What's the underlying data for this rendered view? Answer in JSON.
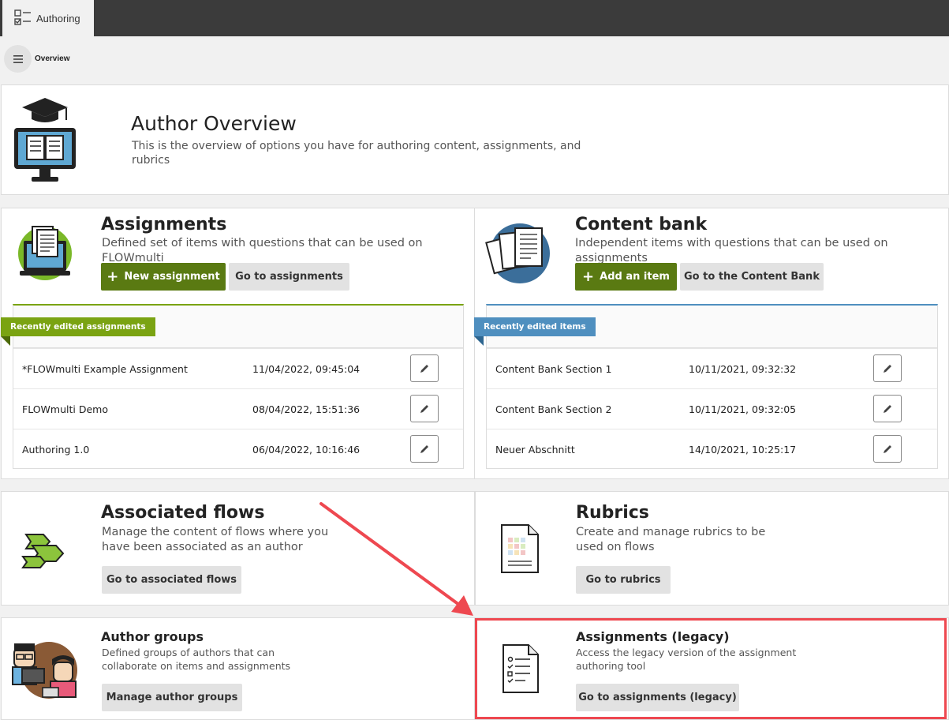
{
  "app": {
    "tab_label": "Authoring",
    "breadcrumb": "Overview"
  },
  "header": {
    "title": "Author Overview",
    "description": "This is the overview of options you have for authoring content, assignments, and rubrics"
  },
  "assignments": {
    "title": "Assignments",
    "description": "Defined set of items with questions that can be used on FLOWmulti",
    "new_button": "New assignment",
    "go_button": "Go to assignments",
    "recent_label": "Recently edited assignments",
    "rows": [
      {
        "name": "*FLOWmulti Example Assignment",
        "date": "11/04/2022, 09:45:04"
      },
      {
        "name": "FLOWmulti Demo",
        "date": "08/04/2022, 15:51:36"
      },
      {
        "name": "Authoring 1.0",
        "date": "06/04/2022, 10:16:46"
      }
    ]
  },
  "content_bank": {
    "title": "Content bank",
    "description": "Independent items with questions that can be used on assignments",
    "add_button": "Add an item",
    "go_button": "Go to the Content Bank",
    "recent_label": "Recently edited items",
    "rows": [
      {
        "name": "Content Bank Section 1",
        "date": "10/11/2021, 09:32:32"
      },
      {
        "name": "Content Bank Section 2",
        "date": "10/11/2021, 09:32:05"
      },
      {
        "name": "Neuer Abschnitt",
        "date": "14/10/2021, 10:25:17"
      }
    ]
  },
  "flows": {
    "title": "Associated flows",
    "description": "Manage the content of flows where you have been associated as an author",
    "go_button": "Go to associated flows"
  },
  "rubrics": {
    "title": "Rubrics",
    "description": "Create and manage rubrics to be used on flows",
    "go_button": "Go to rubrics"
  },
  "author_groups": {
    "title": "Author groups",
    "description": "Defined groups of authors that can collaborate on items and assignments",
    "go_button": "Manage author groups"
  },
  "legacy": {
    "title": "Assignments (legacy)",
    "description": "Access the legacy version of the assignment authoring tool",
    "go_button": "Go to assignments (legacy)"
  },
  "colors": {
    "topbar": "#3b3b3b",
    "primary_green": "#5a7a12",
    "assignments_accent": "#7aa312",
    "content_bank_accent": "#4f8fbf",
    "annotation_red": "#ee4850"
  }
}
